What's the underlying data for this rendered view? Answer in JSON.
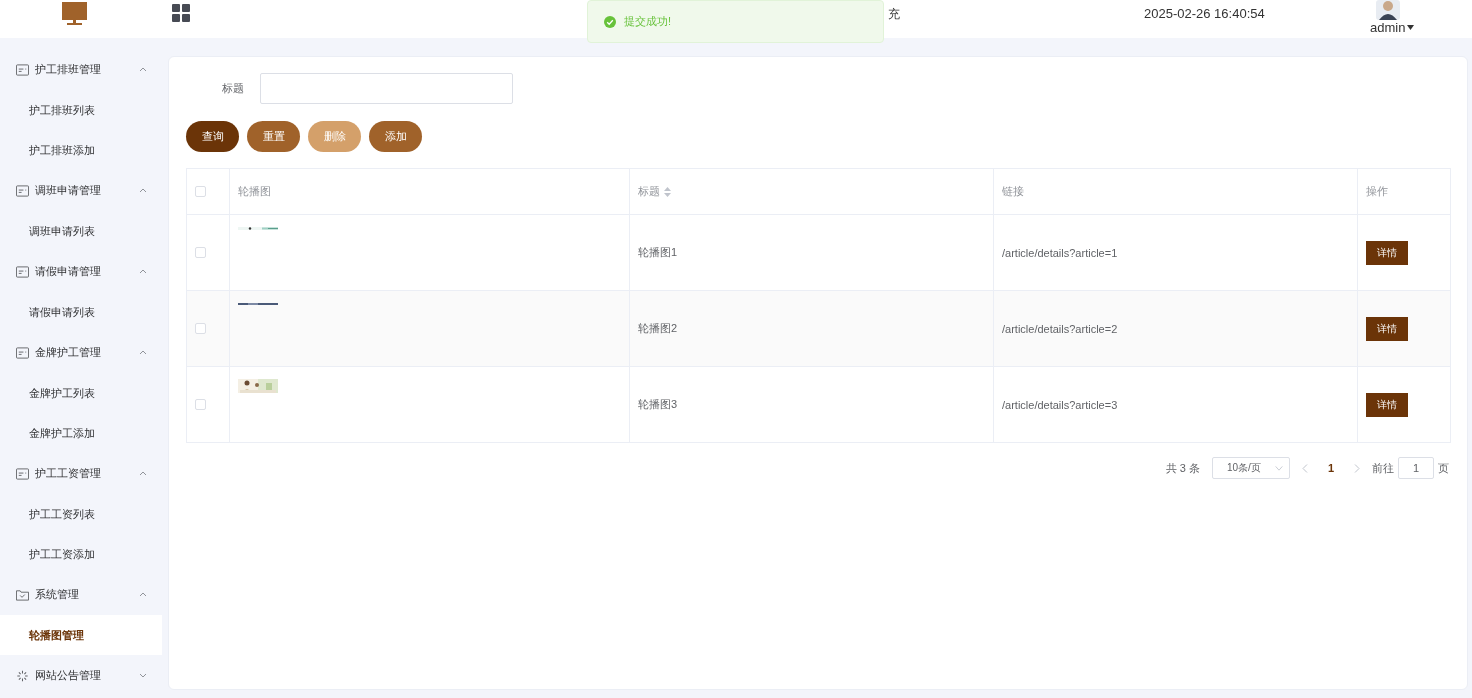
{
  "header": {
    "title": "充",
    "datetime": "2025-02-26 16:40:54",
    "user": "admin"
  },
  "toast": {
    "kind": "success",
    "message": "提交成功!"
  },
  "sidebar": {
    "groups": [
      {
        "label": "护工排班管理",
        "kind": "card",
        "expanded": true,
        "children": [
          {
            "label": "护工排班列表",
            "selected": false
          },
          {
            "label": "护工排班添加",
            "selected": false
          }
        ]
      },
      {
        "label": "调班申请管理",
        "kind": "card",
        "expanded": true,
        "children": [
          {
            "label": "调班申请列表",
            "selected": false
          }
        ]
      },
      {
        "label": "请假申请管理",
        "kind": "card",
        "expanded": true,
        "children": [
          {
            "label": "请假申请列表",
            "selected": false
          }
        ]
      },
      {
        "label": "金牌护工管理",
        "kind": "card",
        "expanded": true,
        "children": [
          {
            "label": "金牌护工列表",
            "selected": false
          },
          {
            "label": "金牌护工添加",
            "selected": false
          }
        ]
      },
      {
        "label": "护工工资管理",
        "kind": "card",
        "expanded": true,
        "children": [
          {
            "label": "护工工资列表",
            "selected": false
          },
          {
            "label": "护工工资添加",
            "selected": false
          }
        ]
      },
      {
        "label": "系统管理",
        "kind": "folder",
        "expanded": true,
        "children": [
          {
            "label": "轮播图管理",
            "selected": true
          }
        ]
      },
      {
        "label": "网站公告管理",
        "kind": "spinner",
        "expanded": false
      }
    ]
  },
  "search": {
    "label": "标题"
  },
  "buttons": [
    {
      "label": "查询",
      "kind": "primary",
      "disabled": false
    },
    {
      "label": "重置",
      "kind": "secondary",
      "disabled": false
    },
    {
      "label": "删除",
      "kind": "danger",
      "disabled": true
    },
    {
      "label": "添加",
      "kind": "secondary",
      "disabled": false
    }
  ],
  "table": {
    "header_checked": false,
    "columns": [
      "轮播图",
      "标题",
      "链接",
      "操作"
    ],
    "rows": [
      {
        "checked": false,
        "title": "轮播图1",
        "link": "/article/details?article=1",
        "action": "详情"
      },
      {
        "checked": false,
        "title": "轮播图2",
        "link": "/article/details?article=2",
        "action": "详情"
      },
      {
        "checked": false,
        "title": "轮播图3",
        "link": "/article/details?article=3",
        "action": "详情"
      }
    ]
  },
  "pagination": {
    "total": "共 3 条",
    "page_size": "10条/页",
    "pages": [
      {
        "label": "1",
        "selected": true
      }
    ],
    "goto_label": "前往",
    "goto_value": "1",
    "goto_suffix": "页"
  }
}
